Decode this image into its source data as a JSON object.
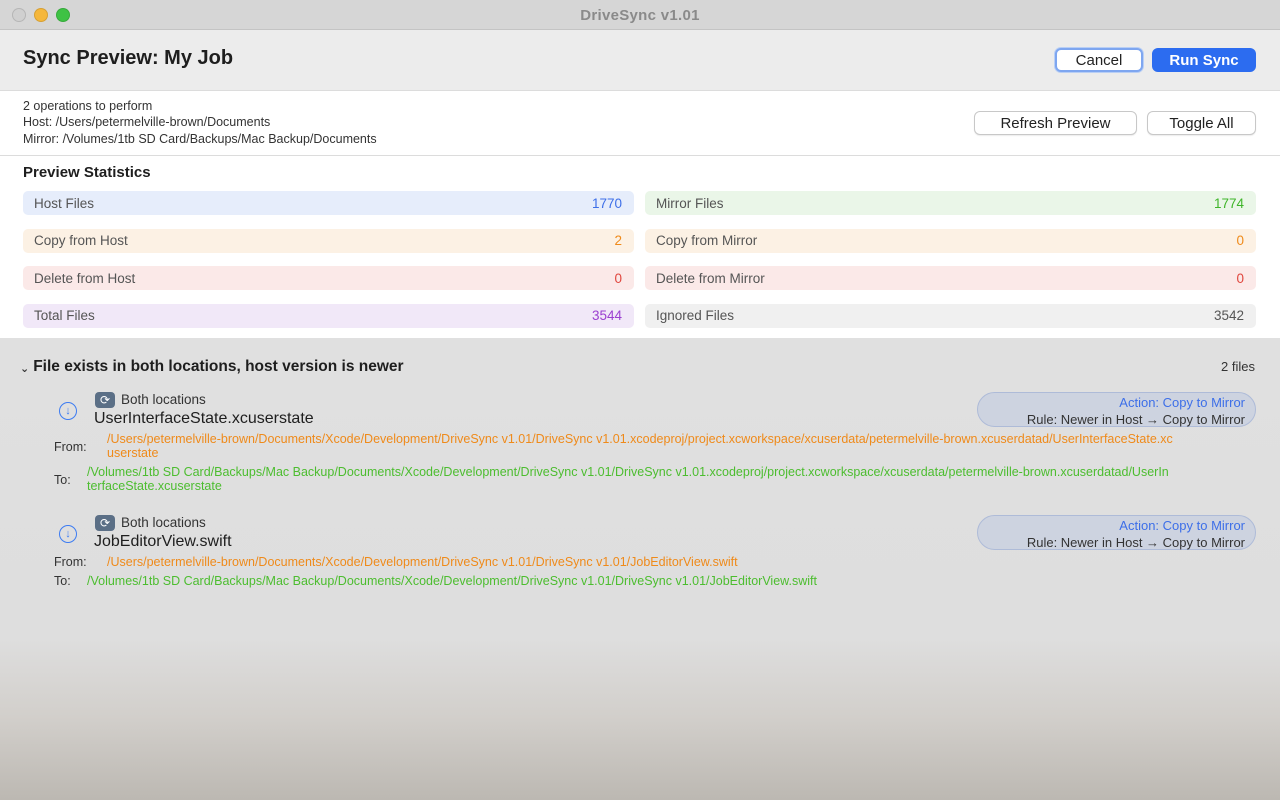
{
  "window": {
    "title": "DriveSync v1.01"
  },
  "sheet": {
    "title": "Sync Preview: My Job",
    "cancel_label": "Cancel",
    "run_label": "Run Sync"
  },
  "info": {
    "operations": "2 operations to perform",
    "host": "Host: /Users/petermelville-brown/Documents",
    "mirror": "Mirror: /Volumes/1tb SD Card/Backups/Mac Backup/Documents",
    "refresh_label": "Refresh Preview",
    "toggle_label": "Toggle All"
  },
  "stats": {
    "title": "Preview Statistics",
    "items": [
      {
        "label": "Host Files",
        "value": "1770",
        "color": "#3d6fe8",
        "bg": "#e6edfb"
      },
      {
        "label": "Mirror Files",
        "value": "1774",
        "color": "#3fb52a",
        "bg": "#eaf6e8"
      },
      {
        "label": "Copy from Host",
        "value": "2",
        "color": "#ef8a1a",
        "bg": "#fcf1e4"
      },
      {
        "label": "Copy from Mirror",
        "value": "0",
        "color": "#ef8a1a",
        "bg": "#fcf1e4"
      },
      {
        "label": "Delete from Host",
        "value": "0",
        "color": "#e0463d",
        "bg": "#fbe9e8"
      },
      {
        "label": "Delete from Mirror",
        "value": "0",
        "color": "#e0463d",
        "bg": "#fbe9e8"
      },
      {
        "label": "Total Files",
        "value": "3544",
        "color": "#9b3fd0",
        "bg": "#f1e8f8"
      },
      {
        "label": "Ignored Files",
        "value": "3542",
        "color": "#555555",
        "bg": "#f0f0f0"
      }
    ]
  },
  "group": {
    "title": "File exists in both locations, host version is newer",
    "count": "2 files",
    "items": [
      {
        "location": "Both locations",
        "name": "UserInterfaceState.xcuserstate",
        "action": "Action: Copy to Mirror",
        "rule": "Rule: Newer in Host → Copy to Mirror",
        "from_label": "From:",
        "from": "/Users/petermelville-brown/Documents/Xcode/Development/DriveSync v1.01/DriveSync v1.01.xcodeproj/project.xcworkspace/xcuserdata/petermelville-brown.xcuserdatad/UserInterfaceState.xcuserstate",
        "to_label": "To:",
        "to": "/Volumes/1tb SD Card/Backups/Mac Backup/Documents/Xcode/Development/DriveSync v1.01/DriveSync v1.01.xcodeproj/project.xcworkspace/xcuserdata/petermelville-brown.xcuserdatad/UserInterfaceState.xcuserstate"
      },
      {
        "location": "Both locations",
        "name": "JobEditorView.swift",
        "action": "Action: Copy to Mirror",
        "rule": "Rule: Newer in Host → Copy to Mirror",
        "from_label": "From:",
        "from": "/Users/petermelville-brown/Documents/Xcode/Development/DriveSync v1.01/DriveSync v1.01/JobEditorView.swift",
        "to_label": "To:",
        "to": "/Volumes/1tb SD Card/Backups/Mac Backup/Documents/Xcode/Development/DriveSync v1.01/DriveSync v1.01/JobEditorView.swift"
      }
    ]
  }
}
